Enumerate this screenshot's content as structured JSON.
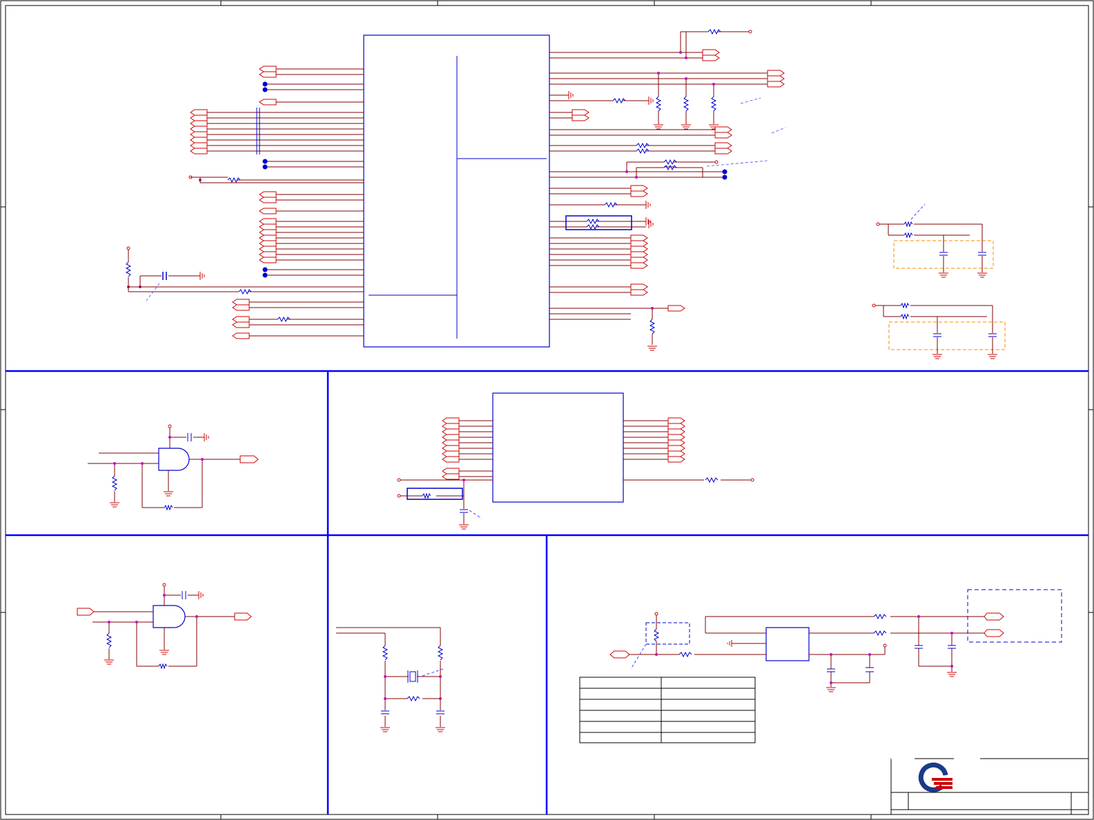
{
  "sheet": {
    "colors": {
      "frame": "#000000",
      "section_border": "#0000ff",
      "wire": "#800000",
      "port": "#cc0000",
      "component": "#0000cc",
      "junction": "#cc00cc",
      "ground": "#cc0000",
      "annotation": "#4444ff",
      "option_box": "#ff8800"
    },
    "sections": [
      {
        "id": "top-ic-block"
      },
      {
        "id": "and-gate-block-1"
      },
      {
        "id": "ic-block-2"
      },
      {
        "id": "and-gate-block-2"
      },
      {
        "id": "crystal-block"
      },
      {
        "id": "regulator-block"
      }
    ],
    "table": {
      "rows": 6,
      "cols": 2
    },
    "title_block": {
      "logo": "quanta-logo"
    }
  }
}
